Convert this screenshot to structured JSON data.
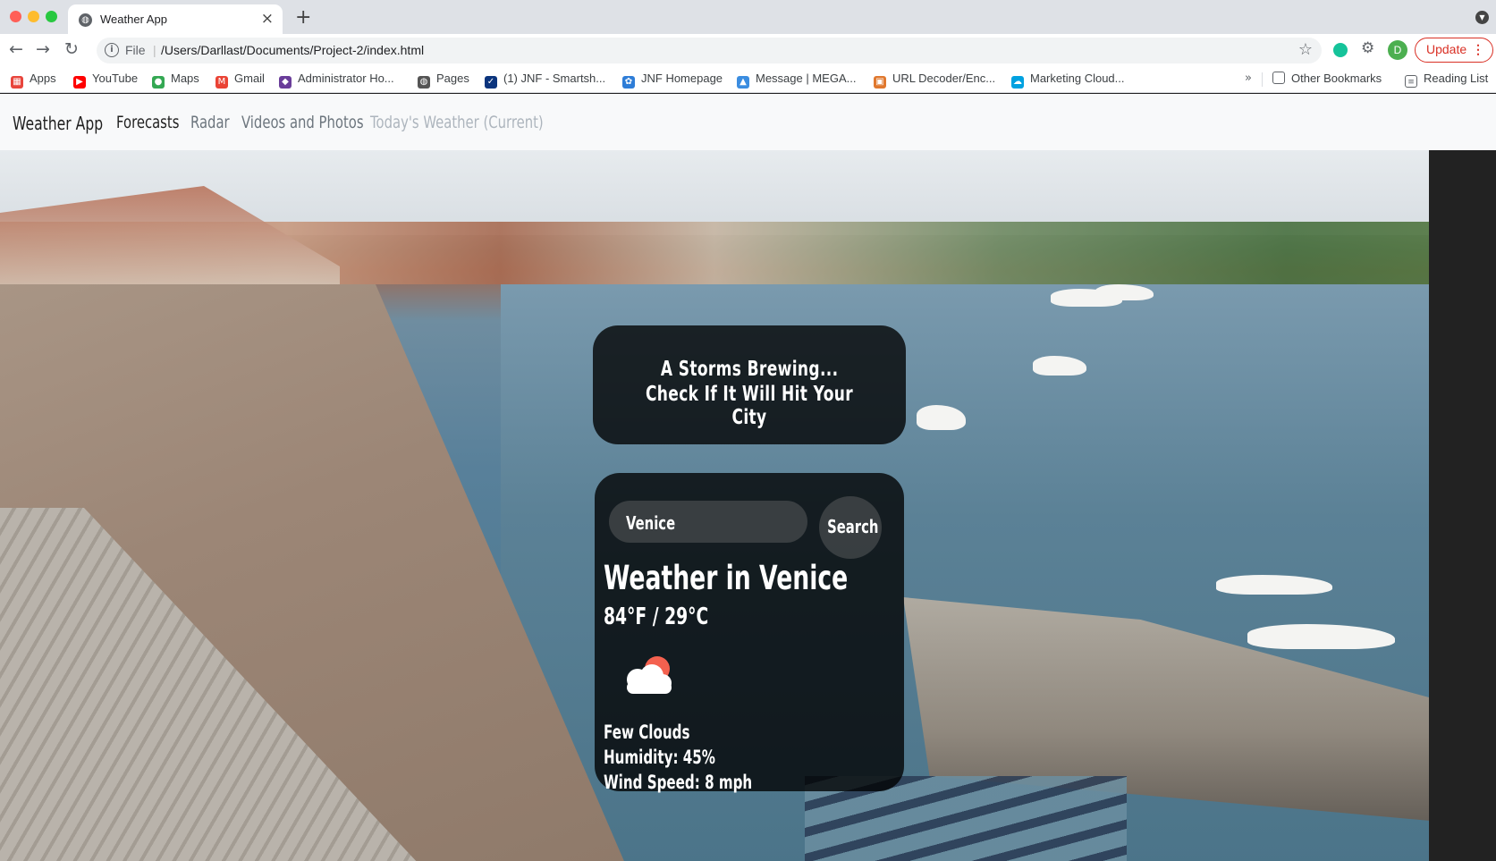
{
  "browser": {
    "tab_title": "Weather App",
    "url_scheme": "File",
    "url": "/Users/Darllast/Documents/Project-2/index.html",
    "update_label": "Update",
    "profile_initial": "D",
    "bookmarks": [
      {
        "label": "Apps",
        "icon": "apps-grid-icon"
      },
      {
        "label": "YouTube",
        "icon": "youtube-icon"
      },
      {
        "label": "Maps",
        "icon": "maps-pin-icon"
      },
      {
        "label": "Gmail",
        "icon": "gmail-icon"
      },
      {
        "label": "Administrator Ho...",
        "icon": "admin-icon"
      },
      {
        "label": "Pages",
        "icon": "pages-icon"
      },
      {
        "label": "(1) JNF - Smartsh...",
        "icon": "smartsheet-icon"
      },
      {
        "label": "JNF Homepage",
        "icon": "jnf-icon"
      },
      {
        "label": "Message | MEGA...",
        "icon": "mega-icon"
      },
      {
        "label": "URL Decoder/Enc...",
        "icon": "url-decoder-icon"
      },
      {
        "label": "Marketing Cloud...",
        "icon": "salesforce-cloud-icon"
      }
    ],
    "other_bookmarks": "Other Bookmarks",
    "reading_list": "Reading List"
  },
  "navbar": {
    "brand": "Weather App",
    "links": [
      "Forecasts",
      "Radar",
      "Videos and Photos",
      "Today's Weather (Current)"
    ]
  },
  "tagline": {
    "line1": "A Storms Brewing...",
    "line2": "Check If It Will Hit Your City"
  },
  "weather": {
    "search_value": "Venice",
    "search_button": "Search",
    "title": "Weather in Venice",
    "temperature": "84°F / 29°C",
    "icon": "few-clouds-icon",
    "description": "Few Clouds",
    "humidity": "Humidity: 45%",
    "wind": "Wind Speed: 8 mph"
  }
}
